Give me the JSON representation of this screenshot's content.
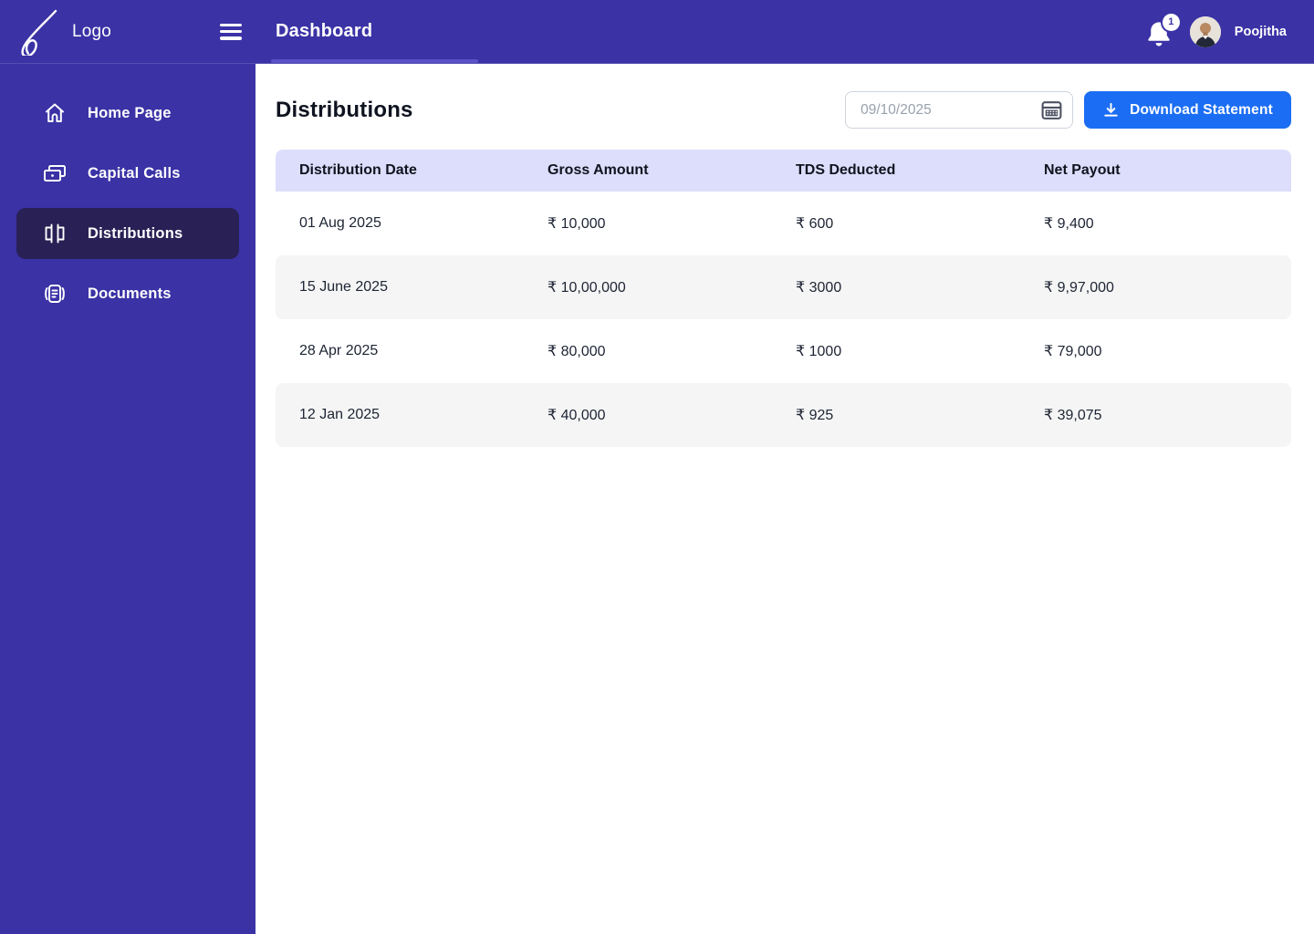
{
  "header": {
    "logo_text": "Logo",
    "title": "Dashboard",
    "notification_count": "1",
    "user_name": "Poojitha"
  },
  "sidebar": {
    "items": [
      {
        "label": "Home Page",
        "icon": "home-icon",
        "active": false
      },
      {
        "label": "Capital Calls",
        "icon": "capital-calls-icon",
        "active": false
      },
      {
        "label": "Distributions",
        "icon": "distributions-icon",
        "active": true
      },
      {
        "label": "Documents",
        "icon": "documents-icon",
        "active": false
      }
    ]
  },
  "main": {
    "page_title": "Distributions",
    "date_input": {
      "placeholder": "09/10/2025",
      "icon": "calendar-icon"
    },
    "download_button": {
      "label": "Download Statement",
      "icon": "download-icon"
    },
    "table": {
      "columns": [
        "Distribution Date",
        "Gross Amount",
        "TDS Deducted",
        "Net Payout"
      ],
      "rows": [
        [
          "01 Aug 2025",
          "₹ 10,000",
          "₹ 600",
          "₹ 9,400"
        ],
        [
          "15 June 2025",
          "₹ 10,00,000",
          "₹ 3000",
          "₹ 9,97,000"
        ],
        [
          "28 Apr 2025",
          "₹ 80,000",
          "₹ 1000",
          "₹ 79,000"
        ],
        [
          "12 Jan 2025",
          "₹ 40,000",
          "₹ 925",
          "₹ 39,075"
        ]
      ]
    }
  },
  "colors": {
    "brand_indigo": "#3a32a5",
    "active_nav": "#292155",
    "accent_blue": "#1b6ef3",
    "table_header_bg": "#dcdefb",
    "row_stripe": "#f5f5f5"
  }
}
